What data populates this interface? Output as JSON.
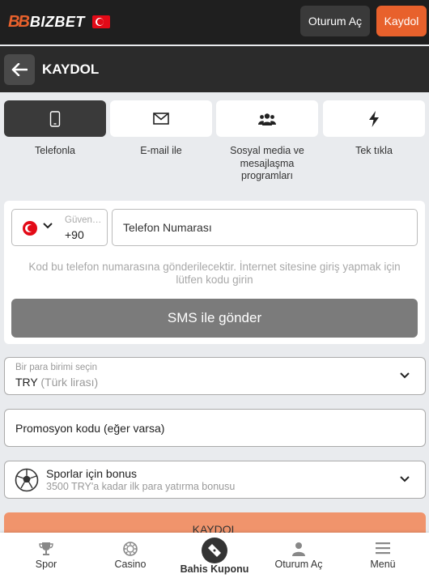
{
  "header": {
    "logo_mark": "BB",
    "logo_text": "BIZBET",
    "login_label": "Oturum Aç",
    "register_label": "Kaydol"
  },
  "subheader": {
    "title": "KAYDOL"
  },
  "tabs": [
    {
      "label": "Telefonla",
      "icon": "phone-icon",
      "active": true
    },
    {
      "label": "E-mail ile",
      "icon": "mail-icon",
      "active": false
    },
    {
      "label": "Sosyal media ve mesajlaşma programları",
      "icon": "users-icon",
      "active": false
    },
    {
      "label": "Tek tıkla",
      "icon": "lightning-icon",
      "active": false
    }
  ],
  "phone": {
    "country_label": "Güvenlik kodu",
    "country_code": "+90",
    "placeholder": "Telefon Numarası",
    "hint": "Kod bu telefon numarasına gönderilecektir. İnternet sitesine giriş yapmak için lütfen kodu girin",
    "sms_button": "SMS ile gönder"
  },
  "currency": {
    "label": "Bir para birimi seçin",
    "value": "TRY",
    "value_detail": "(Türk lirası)"
  },
  "promo": {
    "placeholder": "Promosyon kodu (eğer varsa)"
  },
  "bonus": {
    "title": "Sporlar için bonus",
    "subtitle": "3500 TRY'a kadar ilk para yatırma bonusu"
  },
  "submit_label": "KAYDOL",
  "bottom_nav": [
    {
      "label": "Spor",
      "icon": "trophy-icon"
    },
    {
      "label": "Casino",
      "icon": "casino-chip-icon"
    },
    {
      "label": "Bahis Kuponu",
      "icon": "ticket-icon"
    },
    {
      "label": "Oturum Aç",
      "icon": "user-icon"
    },
    {
      "label": "Menü",
      "icon": "hamburger-icon"
    }
  ],
  "colors": {
    "accent": "#e8612c",
    "header_bg": "#1f1f1f",
    "subheader_bg": "#2b2b2b",
    "page_bg": "#e9ebee",
    "sms_button": "#7b7b7b",
    "submit_button": "#f0946c"
  }
}
